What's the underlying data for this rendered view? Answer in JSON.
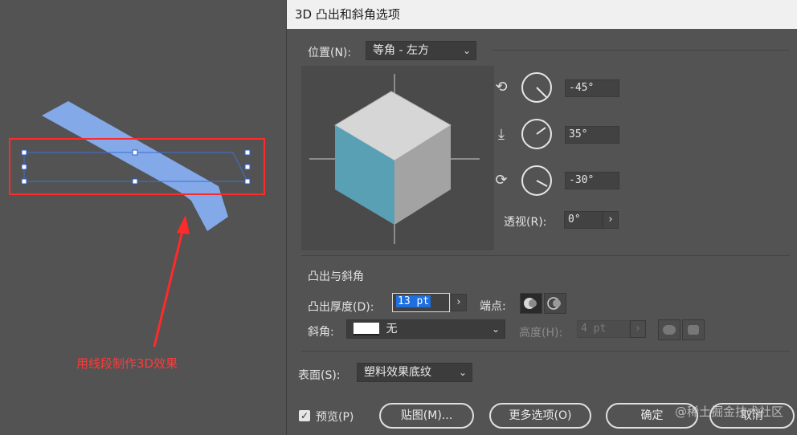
{
  "canvas": {
    "annotation": "用线段制作3D效果"
  },
  "dialog": {
    "title": "3D 凸出和斜角选项",
    "position": {
      "label": "位置(N):",
      "value": "等角 - 左方"
    },
    "rotation": {
      "x_value": "-45°",
      "y_value": "35°",
      "z_value": "-30°",
      "perspective_label": "透视(R):",
      "perspective_value": "0°"
    },
    "extrude": {
      "section_title": "凸出与斜角",
      "depth_label": "凸出厚度(D):",
      "depth_value": "13 pt",
      "cap_label": "端点:",
      "bevel_label": "斜角:",
      "bevel_value": "无",
      "height_label": "高度(H):",
      "height_value": "4 pt"
    },
    "surface": {
      "label": "表面(S):",
      "value": "塑料效果底纹"
    },
    "footer": {
      "preview_label": "预览(P)",
      "map_button": "贴图(M)...",
      "more_button": "更多选项(O)",
      "ok_button": "确定",
      "cancel_button": "取消"
    },
    "watermark": "@稀土掘金技术社区"
  },
  "colors": {
    "cube_left": "#5aa0b5",
    "cube_top": "#d6d6d6",
    "cube_right": "#a3a3a3",
    "shape_fill": "#86aef0",
    "annotation": "#ff3a3a"
  }
}
